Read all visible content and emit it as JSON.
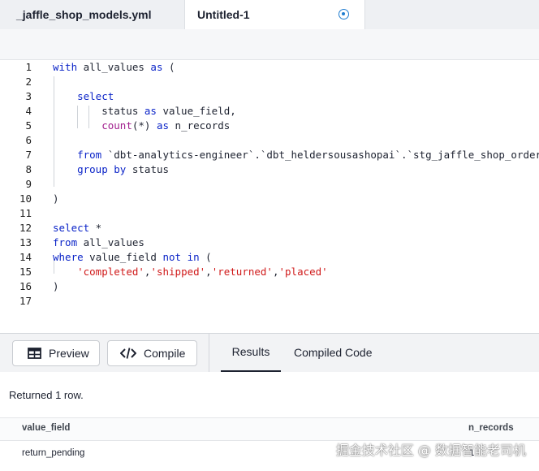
{
  "tabs": [
    {
      "label": "_jaffle_shop_models.yml"
    },
    {
      "label": "Untitled-1"
    }
  ],
  "editor": {
    "lines": [
      {
        "n": "1",
        "tokens": [
          {
            "t": "with",
            "c": "kw"
          },
          {
            "t": " all_values "
          },
          {
            "t": "as",
            "c": "kw"
          },
          {
            "t": " ("
          }
        ]
      },
      {
        "n": "2",
        "tokens": []
      },
      {
        "n": "3",
        "tokens": [
          {
            "t": "    "
          },
          {
            "t": "select",
            "c": "kw"
          }
        ]
      },
      {
        "n": "4",
        "tokens": [
          {
            "t": "        status "
          },
          {
            "t": "as",
            "c": "kw"
          },
          {
            "t": " value_field,"
          }
        ]
      },
      {
        "n": "5",
        "tokens": [
          {
            "t": "        "
          },
          {
            "t": "count",
            "c": "fn"
          },
          {
            "t": "(*) "
          },
          {
            "t": "as",
            "c": "kw"
          },
          {
            "t": " n_records"
          }
        ]
      },
      {
        "n": "6",
        "tokens": []
      },
      {
        "n": "7",
        "tokens": [
          {
            "t": "    "
          },
          {
            "t": "from",
            "c": "kw"
          },
          {
            "t": " `dbt-analytics-engineer`.`dbt_heldersousashopai`.`stg_jaffle_shop_orders`"
          }
        ]
      },
      {
        "n": "8",
        "tokens": [
          {
            "t": "    "
          },
          {
            "t": "group",
            "c": "kw"
          },
          {
            "t": " "
          },
          {
            "t": "by",
            "c": "kw"
          },
          {
            "t": " status"
          }
        ]
      },
      {
        "n": "9",
        "tokens": []
      },
      {
        "n": "10",
        "tokens": [
          {
            "t": ")"
          }
        ]
      },
      {
        "n": "11",
        "tokens": []
      },
      {
        "n": "12",
        "tokens": [
          {
            "t": "select",
            "c": "kw"
          },
          {
            "t": " *"
          }
        ]
      },
      {
        "n": "13",
        "tokens": [
          {
            "t": "from",
            "c": "kw"
          },
          {
            "t": " all_values"
          }
        ]
      },
      {
        "n": "14",
        "tokens": [
          {
            "t": "where",
            "c": "kw"
          },
          {
            "t": " value_field "
          },
          {
            "t": "not",
            "c": "kw"
          },
          {
            "t": " "
          },
          {
            "t": "in",
            "c": "kw"
          },
          {
            "t": " ("
          }
        ]
      },
      {
        "n": "15",
        "tokens": [
          {
            "t": "    "
          },
          {
            "t": "'completed'",
            "c": "str"
          },
          {
            "t": ","
          },
          {
            "t": "'shipped'",
            "c": "str"
          },
          {
            "t": ","
          },
          {
            "t": "'returned'",
            "c": "str"
          },
          {
            "t": ","
          },
          {
            "t": "'placed'",
            "c": "str"
          }
        ]
      },
      {
        "n": "16",
        "tokens": [
          {
            "t": ")"
          }
        ]
      },
      {
        "n": "17",
        "tokens": []
      }
    ]
  },
  "toolbar": {
    "preview_label": "Preview",
    "compile_label": "Compile"
  },
  "result_tabs": {
    "results_label": "Results",
    "compiled_label": "Compiled Code"
  },
  "results": {
    "status": "Returned 1 row.",
    "columns": [
      "value_field",
      "n_records"
    ],
    "rows": [
      [
        "return_pending",
        "1"
      ]
    ]
  },
  "watermark": "掘金技术社区 @ 数据智能老司机",
  "colors": {
    "keyword": "#0b24c8",
    "string": "#d01a1a",
    "function": "#a2208e",
    "active_tab_indicator": "#1f7ccf"
  }
}
